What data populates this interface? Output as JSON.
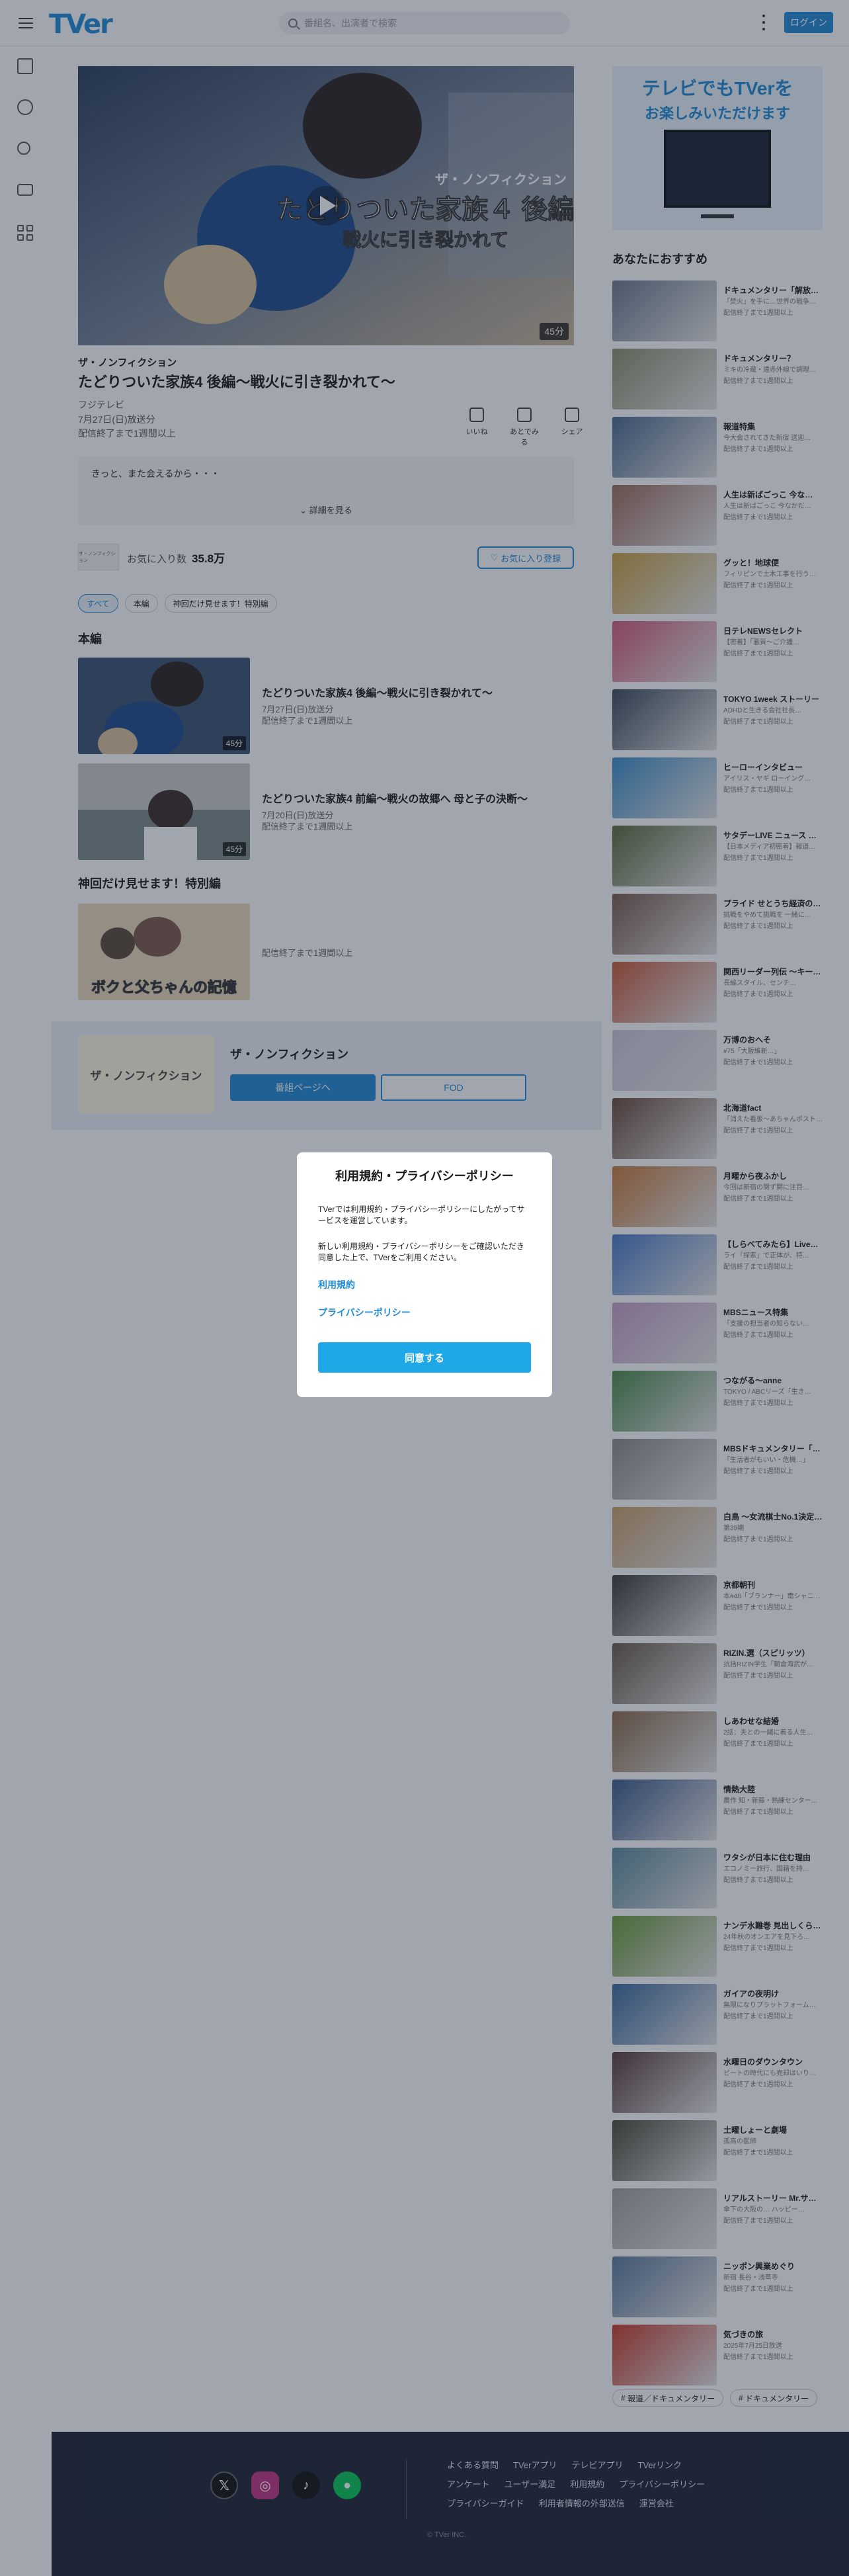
{
  "header": {
    "logo": "TVer",
    "search_placeholder": "番組名、出演者で検索",
    "login_label": "ログイン"
  },
  "episode": {
    "series": "ザ・ノンフィクション",
    "title": "たどりついた家族4 後編〜戦火に引き裂かれて〜",
    "broadcaster": "フジテレビ",
    "air_date": "7月27日(日)放送分",
    "availability": "配信終了まで1週間以上",
    "duration_badge": "45分",
    "overlay_series": "ザ・ノンフィクション",
    "overlay_title": "たどりついた家族４ 後編",
    "overlay_sub": "戦火に引き裂かれて"
  },
  "actions": [
    {
      "label": "いいね"
    },
    {
      "label": "あとでみる"
    },
    {
      "label": "シェア"
    }
  ],
  "description": {
    "text": "きっと、また会えるから・・・",
    "more_label": "詳細を見る"
  },
  "provider": {
    "logo_text": "ザ・ノンフィクション",
    "fav_label": "お気に入り数",
    "fav_count": "35.8万",
    "fav_button": "お気に入り登録"
  },
  "chips": [
    "すべて",
    "本編",
    "神回だけ見せます！特別編"
  ],
  "sections": {
    "main": "本編",
    "special": "神回だけ見せます！特別編"
  },
  "episodes": [
    {
      "title": "たどりついた家族4 後編〜戦火に引き裂かれて〜",
      "date": "7月27日(日)放送分",
      "avail": "配信終了まで1週間以上",
      "dur": "45分"
    },
    {
      "title": "たどりついた家族4 前編〜戦火の故郷へ 母と子の決断〜",
      "date": "7月20日(日)放送分",
      "avail": "配信終了まで1週間以上",
      "dur": "45分"
    },
    {
      "title": "",
      "date": "",
      "avail": "配信終了まで1週間以上",
      "dur": ""
    }
  ],
  "special_thumb_text": "ボクと父ちゃんの記憶",
  "series_band": {
    "title": "ザ・ノンフィクション",
    "page_button": "番組ページへ",
    "fod_button": "FOD"
  },
  "tv_promo": {
    "line1": "テレビでもTVerを",
    "line2": "お楽しみいただけます"
  },
  "recommend_title": "あなたにおすすめ",
  "recommendations": [
    {
      "t": "ドキュメンタリー「解放区」",
      "s": "「焚火」を手に…世界の戦争…",
      "s2": "配信終了まで1週間以上",
      "c": "#6b7a8c"
    },
    {
      "t": "ドキュメンタリー？",
      "s": "ミキの冷蔵・遠赤外線で調理…",
      "s2": "配信終了まで1週間以上",
      "c": "#8c8f6b"
    },
    {
      "t": "報道特集",
      "s": "今大会されてきた新宿 送迎…",
      "s2": "配信終了まで1週間以上",
      "c": "#4a6a8c"
    },
    {
      "t": "人生は新ばごっこ 今な…",
      "s": "人生は新ばごっこ 今なかだ…",
      "s2": "配信終了まで1週間以上",
      "c": "#9c6b5a"
    },
    {
      "t": "グッと！地球便",
      "s": "フィリピンで土木工事を行う…",
      "s2": "配信終了まで1週間以上",
      "c": "#c8a040"
    },
    {
      "t": "日テレNEWSセレクト",
      "s": "【密着】「悪質〜ご介護…",
      "s2": "配信終了まで1週間以上",
      "c": "#d45a7a"
    },
    {
      "t": "TOKYO 1week ストーリー",
      "s": "ADHDと生きる会社社長…",
      "s2": "配信終了まで1週間以上",
      "c": "#3a4a5a"
    },
    {
      "t": "ヒーローインタビュー",
      "s": "アイリス・ヤギ ローイング…",
      "s2": "配信終了まで1週間以上",
      "c": "#3a8cc8"
    },
    {
      "t": "サタデーLIVE ニュース ジャポン",
      "s": "【日本メディア初密着】報道…",
      "s2": "配信終了まで1週間以上",
      "c": "#5a6a3a"
    },
    {
      "t": "プライド せとうち経済の…",
      "s": "挑戦をやめて挑戦を 一緒に…",
      "s2": "配信終了まで1週間以上",
      "c": "#7a5a4a"
    },
    {
      "t": "関西リーダー列伝 〜キー…",
      "s": "長編スタイル、センチ…",
      "s2": "配信終了まで1週間以上",
      "c": "#c85a3a"
    },
    {
      "t": "万博のおへそ",
      "s": "#75「大阪維新…」",
      "s2": "配信終了まで1週間以上",
      "c": "#c8c8d8"
    },
    {
      "t": "北海道fact",
      "s": "「消えた看板〜あちゃんポスト…",
      "s2": "配信終了まで1週間以上",
      "c": "#6a4a3a"
    },
    {
      "t": "月曜から夜ふかし",
      "s": "今回は新宿の関ず関に注目…",
      "s2": "配信終了まで1週間以上",
      "c": "#c87a3a"
    },
    {
      "t": "【しらべてみたら】Live…",
      "s": "ライ「探索」で正体が、特…",
      "s2": "配信終了まで1週間以上",
      "c": "#4a7ac8"
    },
    {
      "t": "MBSニュース特集",
      "s": "「支援の担当者の知らない…",
      "s2": "配信終了まで1週間以上",
      "c": "#c8a0c8"
    },
    {
      "t": "つながる〜anne",
      "s": "TOKYO / ABCリーズ「生き…",
      "s2": "配信終了まで1週間以上",
      "c": "#4a8a4a"
    },
    {
      "t": "MBSドキュメンタリー「…",
      "s": "「生活者がもいい・危機…」",
      "s2": "配信終了まで1週間以上",
      "c": "#8a8a8a"
    },
    {
      "t": "白鳥 〜女流棋士No.1決定…",
      "s": "第39期",
      "s2": "配信終了まで1週間以上",
      "c": "#c8a06a"
    },
    {
      "t": "京都朝刊",
      "s": "本#48「ブランナー」南シャニ…",
      "s2": "配信終了まで1週間以上",
      "c": "#3a3a3a"
    },
    {
      "t": "RIZIN.選（スピリッツ）",
      "s": "抗拮RIZIN学生「朝倉海武が…",
      "s2": "配信終了まで1週間以上",
      "c": "#6a5a4a"
    },
    {
      "t": "しあわせな結婚",
      "s": "2話：夫との一緒に着る人生…",
      "s2": "配信終了まで1週間以上",
      "c": "#8a6a4a"
    },
    {
      "t": "情熱大陸",
      "s": "農作 知・新藤・熟練センター…",
      "s2": "配信終了まで1週間以上",
      "c": "#3a5a8a"
    },
    {
      "t": "ワタシが日本に住む理由",
      "s": "エコノミー旅行、国籍を持…",
      "s2": "配信終了まで1週間以上",
      "c": "#5a8a9a"
    },
    {
      "t": "ナンデ水難巻 見出しくら…",
      "s": "24年秋のオンエアを見下ろ…",
      "s2": "配信終了まで1週間以上",
      "c": "#6a9a3a"
    },
    {
      "t": "ガイアの夜明け",
      "s": "無限になりプラットフォーム…",
      "s2": "配信終了まで1週間以上",
      "c": "#3a6aa0"
    },
    {
      "t": "水曜日のダウンタウン",
      "s": "ビートの時代にも売却はいり…",
      "s2": "配信終了まで1週間以上",
      "c": "#5a3a3a"
    },
    {
      "t": "土曜しょーと劇場",
      "s": "孤高の医師",
      "s2": "配信終了まで1週間以上",
      "c": "#4a4a3a"
    },
    {
      "t": "リアルストーリー Mr.サン…",
      "s": "傘下の大阪の… ハッピー…",
      "s2": "配信終了まで1週間以上",
      "c": "#a0a0a0"
    },
    {
      "t": "ニッポン興業めぐり",
      "s": "新宿 長谷・浅草寺",
      "s2": "配信終了まで1週間以上",
      "c": "#5a7a9a"
    },
    {
      "t": "気づきの旅",
      "s": "2025年7月25日放送",
      "s2": "配信終了まで1週間以上",
      "c": "#c83a2a"
    }
  ],
  "tag_chips": [
    "報道／ドキュメンタリー",
    "ドキュメンタリー"
  ],
  "footer": {
    "links": [
      "よくある質問",
      "TVerアプリ",
      "テレビアプリ",
      "TVerリンク",
      "アンケート",
      "ユーザー満足",
      "利用規約",
      "プライバシーポリシー",
      "プライバシーガイド",
      "利用者情報の外部送信",
      "運営会社"
    ],
    "copyright": "© TVer INC."
  },
  "modal": {
    "title": "利用規約・プライバシーポリシー",
    "p1": "TVerでは利用規約・プライバシーポリシーにしたがってサービスを運営しています。",
    "p2": "新しい利用規約・プライバシーポリシーをご確認いただき同意した上で、TVerをご利用ください。",
    "link1": "利用規約",
    "link2": "プライバシーポリシー",
    "agree": "同意する"
  }
}
